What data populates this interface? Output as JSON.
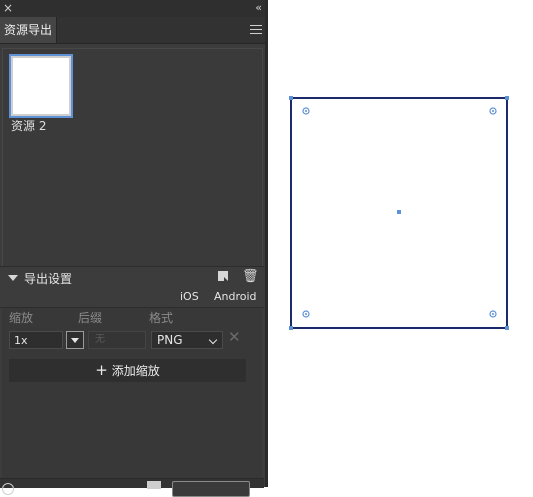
{
  "panel": {
    "close_glyph": "×",
    "collapse_glyph": "‹‹",
    "tab_label": "资源导出",
    "menu_icon": "hamburger-menu-icon"
  },
  "assets": {
    "items": [
      {
        "label": "资源 2"
      }
    ]
  },
  "export_settings": {
    "title": "导出设置",
    "export_icon": "export-icon",
    "trash_icon": "trash-icon",
    "platforms": [
      "iOS",
      "Android"
    ],
    "headers": {
      "scale": "缩放",
      "suffix": "后缀",
      "format": "格式"
    },
    "row": {
      "scale_value": "1x",
      "suffix_placeholder": "无",
      "format_value": "PNG",
      "remove_glyph": "✕"
    },
    "add_scale_label": "添加缩放",
    "add_icon": "+"
  },
  "colors": {
    "panel_bg": "#3c3c3c",
    "selection_blue": "#5e91d6",
    "artboard_border": "#1a2a6a"
  }
}
